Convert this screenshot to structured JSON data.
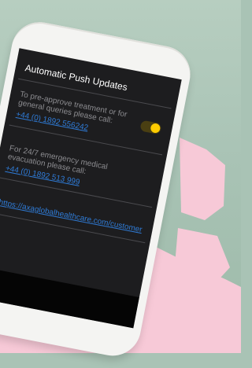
{
  "app": {
    "title": "Automatic Push Updates"
  },
  "section1": {
    "text": "To pre-approve treatment or for general queries please call:",
    "phone": "+44 (0) 1892 556242"
  },
  "section2": {
    "text": "For 24/7 emergency medical evacuation please call:",
    "phone": "+44 (0) 1892 513 999"
  },
  "section3": {
    "link": "https://axaglobalhealthcare.com/customer"
  },
  "toggle": {
    "on": true,
    "accent": "#ffcc00"
  }
}
